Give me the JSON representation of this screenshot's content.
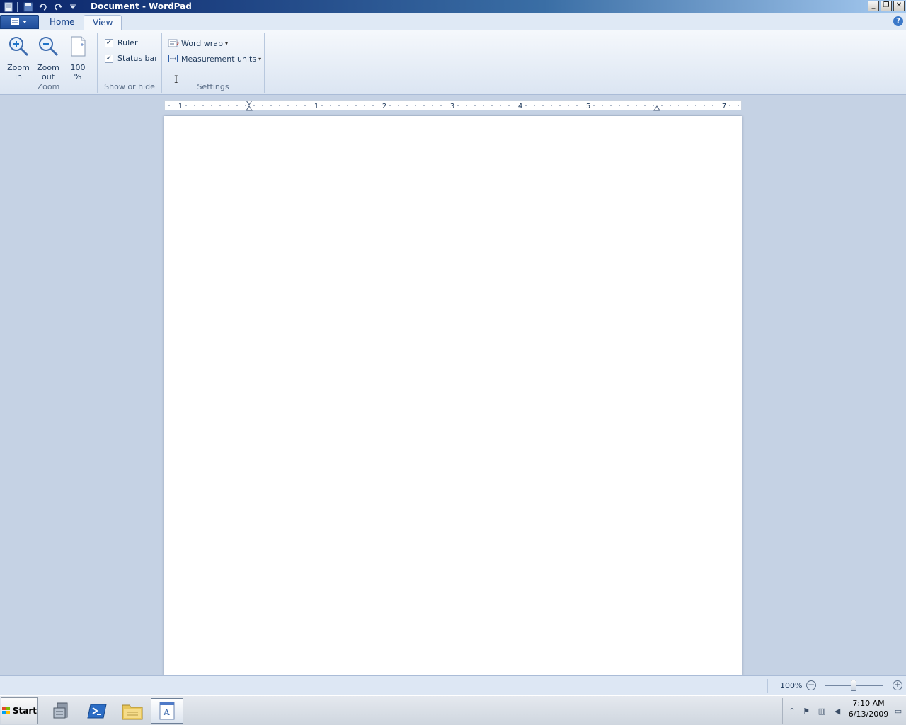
{
  "window": {
    "title": "Document - WordPad"
  },
  "ribbon": {
    "tabs": [
      {
        "label": "Home"
      },
      {
        "label": "View"
      }
    ],
    "active_tab": "View",
    "groups": {
      "zoom": {
        "label": "Zoom",
        "zoom_in_line1": "Zoom",
        "zoom_in_line2": "in",
        "zoom_out_line1": "Zoom",
        "zoom_out_line2": "out",
        "pct_line1": "100",
        "pct_line2": "%"
      },
      "show_hide": {
        "label": "Show or hide",
        "ruler": "Ruler",
        "status_bar": "Status bar",
        "ruler_checked": true,
        "status_bar_checked": true
      },
      "settings": {
        "label": "Settings",
        "word_wrap": "Word wrap",
        "measurement_units": "Measurement units"
      }
    }
  },
  "ruler": {
    "labels": [
      "1",
      "1",
      "2",
      "3",
      "4",
      "5",
      "7"
    ]
  },
  "statusbar": {
    "zoom_level": "100%",
    "zoom_slider_fraction": 0.5
  },
  "taskbar": {
    "start_label": "Start",
    "clock_time": "7:10 AM",
    "clock_date": "6/13/2009"
  }
}
